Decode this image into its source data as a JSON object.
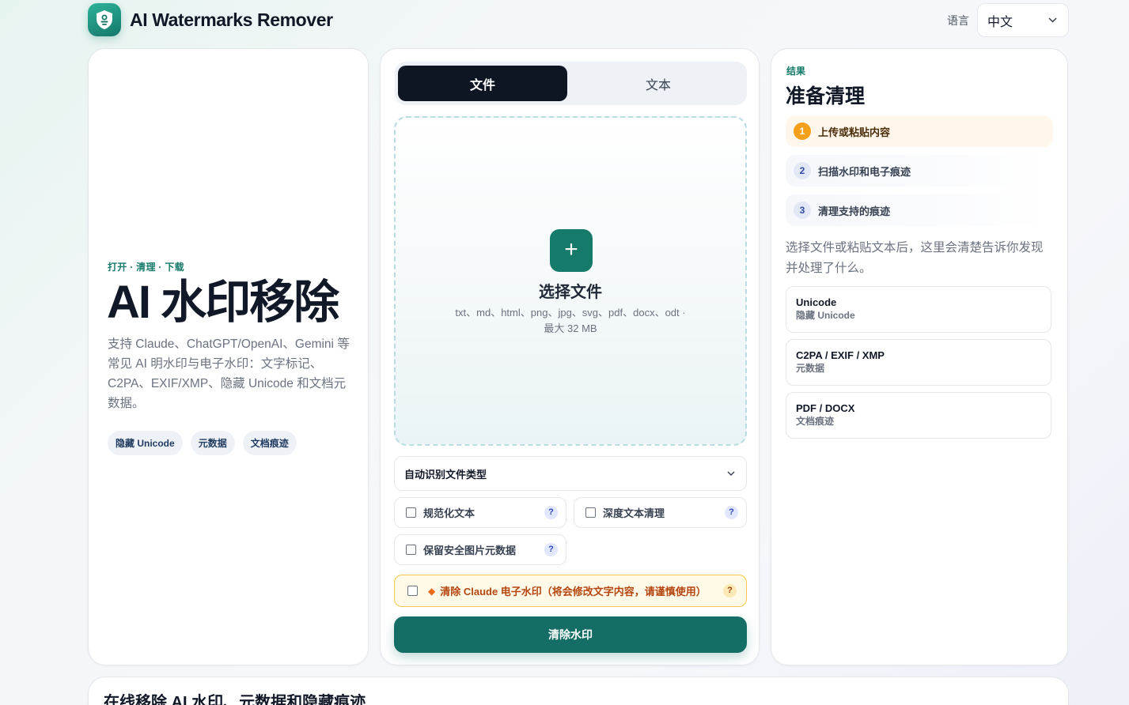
{
  "header": {
    "brand_name": "AI Watermarks Remover",
    "language_label": "语言",
    "language_value": "中文"
  },
  "hero": {
    "eyebrow": "打开 · 清理 · 下载",
    "title": "AI 水印移除",
    "description": "支持 Claude、ChatGPT/OpenAI、Gemini 等常见 AI 明水印与电子水印：文字标记、C2PA、EXIF/XMP、隐藏 Unicode 和文档元数据。",
    "chips": [
      "隐藏 Unicode",
      "元数据",
      "文档痕迹"
    ]
  },
  "workspace": {
    "tabs": [
      {
        "label": "文件",
        "active": true
      },
      {
        "label": "文本",
        "active": false
      }
    ],
    "dropzone": {
      "icon": "plus-icon",
      "title": "选择文件",
      "types": "txt、md、html、png、jpg、svg、pdf、docx、odt ·",
      "max_size": "最大 32 MB"
    },
    "file_type_select": "自动识别文件类型",
    "options": [
      {
        "label": "规范化文本",
        "help": "?"
      },
      {
        "label": "深度文本清理",
        "help": "?"
      },
      {
        "label": "保留安全图片元数据",
        "help": "?"
      }
    ],
    "claude_option": {
      "label": "清除 Claude 电子水印（将会修改文字内容，请谨慎使用）",
      "help": "?"
    },
    "submit_label": "清除水印"
  },
  "result": {
    "eyebrow": "结果",
    "title": "准备清理",
    "steps": [
      {
        "num": "1",
        "label": "上传或粘贴内容"
      },
      {
        "num": "2",
        "label": "扫描水印和电子痕迹"
      },
      {
        "num": "3",
        "label": "清理支持的痕迹"
      }
    ],
    "description": "选择文件或粘贴文本后，这里会清楚告诉你发现并处理了什么。",
    "cards": [
      {
        "title": "Unicode",
        "subtitle": "隐藏 Unicode"
      },
      {
        "title": "C2PA / EXIF / XMP",
        "subtitle": "元数据"
      },
      {
        "title": "PDF / DOCX",
        "subtitle": "文档痕迹"
      }
    ]
  },
  "bottom": {
    "title": "在线移除 AI 水印、元数据和隐藏痕迹"
  },
  "colors": {
    "accent": "#157a6a",
    "primary_button": "#156e66",
    "active_tab": "#0f1623",
    "warning_border": "#f3c84b",
    "warning_text": "#b4470f",
    "step_active": "#f5a01a"
  }
}
